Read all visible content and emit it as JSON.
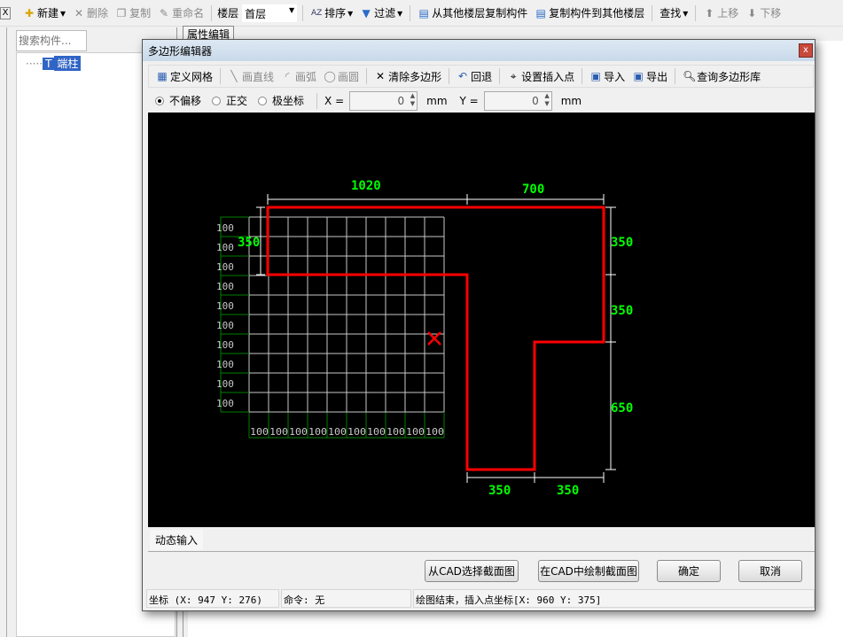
{
  "main_toolbar": {
    "new": "新建",
    "delete": "删除",
    "copy": "复制",
    "rename": "重命名",
    "floor_label": "楼层",
    "floor_value": "首层",
    "sort": "排序",
    "filter": "过滤",
    "copy_from_floor": "从其他楼层复制构件",
    "copy_to_floor": "复制构件到其他楼层",
    "find": "查找",
    "move_up": "上移",
    "move_down": "下移"
  },
  "left_panel": {
    "search_placeholder": "搜索构件...",
    "tree_item": "端柱",
    "prop_tab": "属性编辑"
  },
  "dialog": {
    "title": "多边形编辑器",
    "close": "x",
    "toolbar": {
      "define_grid": "定义网格",
      "draw_line": "画直线",
      "draw_arc": "画弧",
      "draw_circle": "画圆",
      "clear_polygon": "清除多边形",
      "undo": "回退",
      "set_insert_point": "设置插入点",
      "import": "导入",
      "export": "导出",
      "query_library": "查询多边形库"
    },
    "options": {
      "no_offset": "不偏移",
      "orthogonal": "正交",
      "polar": "极坐标",
      "x_label": "X =",
      "x_value": "0",
      "y_label": "Y =",
      "y_value": "0",
      "unit": "mm"
    },
    "canvas": {
      "grid_label": "100",
      "grid_count": 10,
      "dimensions": {
        "top_left": "1020",
        "top_right": "700",
        "left": "350",
        "right_1": "350",
        "right_2": "350",
        "right_3": "650",
        "bottom_left": "350",
        "bottom_right": "350"
      },
      "colors": {
        "background": "#000000",
        "polygon": "#ff0000",
        "dimension_text": "#00ff00",
        "grid": "#c8c8c8",
        "grid_axis": "#008000"
      }
    },
    "tab": "动态输入",
    "buttons": {
      "select_cad": "从CAD选择截面图",
      "draw_cad": "在CAD中绘制截面图",
      "ok": "确定",
      "cancel": "取消"
    },
    "status": {
      "coords": "坐标 (X: 947 Y: 276)",
      "command": "命令: 无",
      "message": "绘图结束，插入点坐标[X: 960 Y: 375]"
    }
  }
}
